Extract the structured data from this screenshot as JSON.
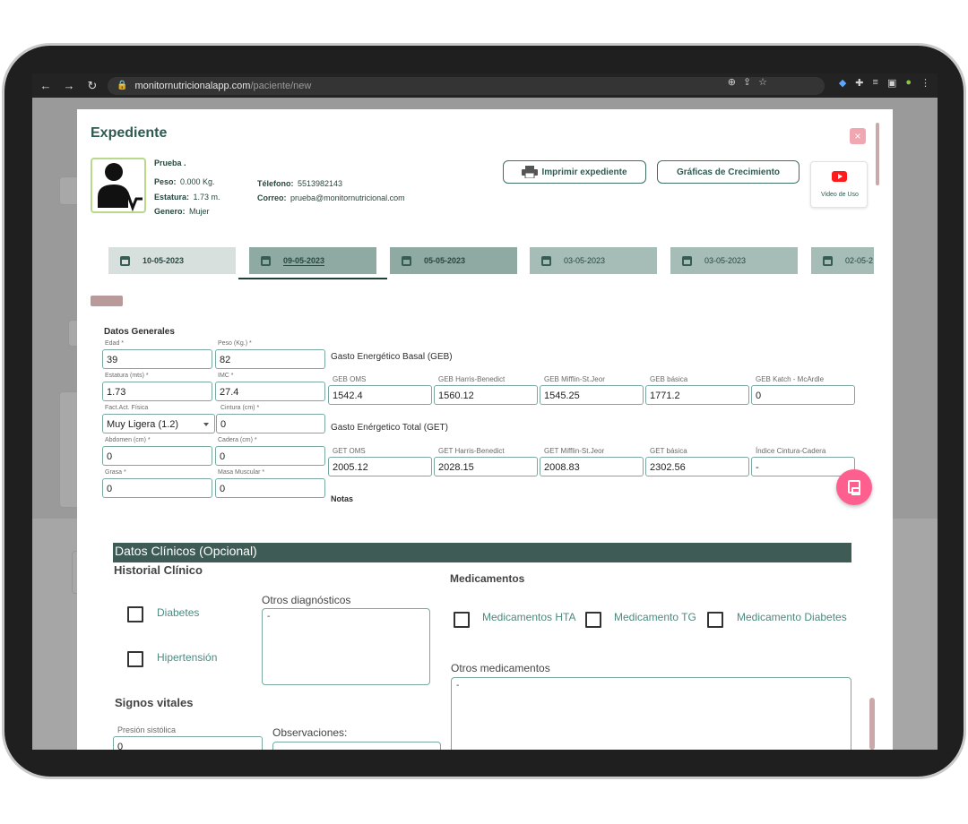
{
  "browser": {
    "url_host": "monitornutricionalapp.com",
    "url_path": "/paciente/new"
  },
  "modal": {
    "title": "Expediente",
    "close_label": "×"
  },
  "patient": {
    "name": "Prueba .",
    "peso_label": "Peso:",
    "peso_value": "0.000 Kg.",
    "estatura_label": "Estatura:",
    "estatura_value": "1.73 m.",
    "genero_label": "Genero:",
    "genero_value": "Mujer",
    "telefono_label": "Télefono:",
    "telefono_value": "5513982143",
    "correo_label": "Correo:",
    "correo_value": "prueba@monitornutricional.com"
  },
  "actions": {
    "print_label": "Imprimir expediente",
    "growth_label": "Gráficas de Crecimiento",
    "video_label": "Video de Uso"
  },
  "date_tabs": [
    "10-05-2023",
    "09-05-2023",
    "05-05-2023",
    "03-05-2023",
    "03-05-2023",
    "02-05-2"
  ],
  "datos_generales": {
    "title": "Datos Generales",
    "edad_label": "Edad *",
    "edad_value": "39",
    "peso_label": "Peso (Kg.) *",
    "peso_value": "82",
    "estatura_label": "Estatura (mts) *",
    "estatura_value": "1.73",
    "imc_label": "IMC *",
    "imc_value": "27.4",
    "fact_label": "Fact.Act. Física",
    "fact_value": "Muy Ligera (1.2)",
    "cintura_label": "Cintura (cm) *",
    "cintura_value": "0",
    "abdomen_label": "Abdomen (cm) *",
    "abdomen_value": "0",
    "cadera_label": "Cadera (cm) *",
    "cadera_value": "0",
    "grasa_label": "Grasa *",
    "grasa_value": "0",
    "masa_label": "Masa Muscular *",
    "masa_value": "0"
  },
  "geb": {
    "title": "Gasto Energético Basal (GEB)",
    "fields": [
      {
        "label": "GEB OMS",
        "value": "1542.4"
      },
      {
        "label": "GEB Harris-Benedict",
        "value": "1560.12"
      },
      {
        "label": "GEB Mifflin-St.Jeor",
        "value": "1545.25"
      },
      {
        "label": "GEB básica",
        "value": "1771.2"
      },
      {
        "label": "GEB Katch - McArdle",
        "value": "0"
      }
    ]
  },
  "get": {
    "title": "Gasto Enérgetico Total (GET)",
    "fields": [
      {
        "label": "GET OMS",
        "value": "2005.12"
      },
      {
        "label": "GET Harris-Benedict",
        "value": "2028.15"
      },
      {
        "label": "GET Mifflin-St.Jeor",
        "value": "2008.83"
      },
      {
        "label": "GET básica",
        "value": "2302.56"
      },
      {
        "label": "Índice Cintura-Cadera",
        "value": "-"
      }
    ]
  },
  "notas_label": "Notas",
  "clinical": {
    "title": "Datos Clínicos (Opcional)",
    "historial_title": "Historial Clínico",
    "diabetes_label": "Diabetes",
    "hipertension_label": "Hipertensión",
    "otros_diag_label": "Otros diagnósticos",
    "otros_diag_value": "-",
    "medicamentos_title": "Medicamentos",
    "med_hta_label": "Medicamentos HTA",
    "med_tg_label": "Medicamento TG",
    "med_diabetes_label": "Medicamento Diabetes",
    "otros_med_label": "Otros medicamentos",
    "otros_med_value": "-",
    "signos_title": "Signos vitales",
    "presion_label": "Presión sistólica",
    "presion_value": "0",
    "observaciones_label": "Observaciones:"
  },
  "colors": {
    "brand": "#2f5a51",
    "tab_active": "#d7e0dd",
    "tab_inactive": "#8fa9a3",
    "save_fab": "#ff5f8f"
  }
}
